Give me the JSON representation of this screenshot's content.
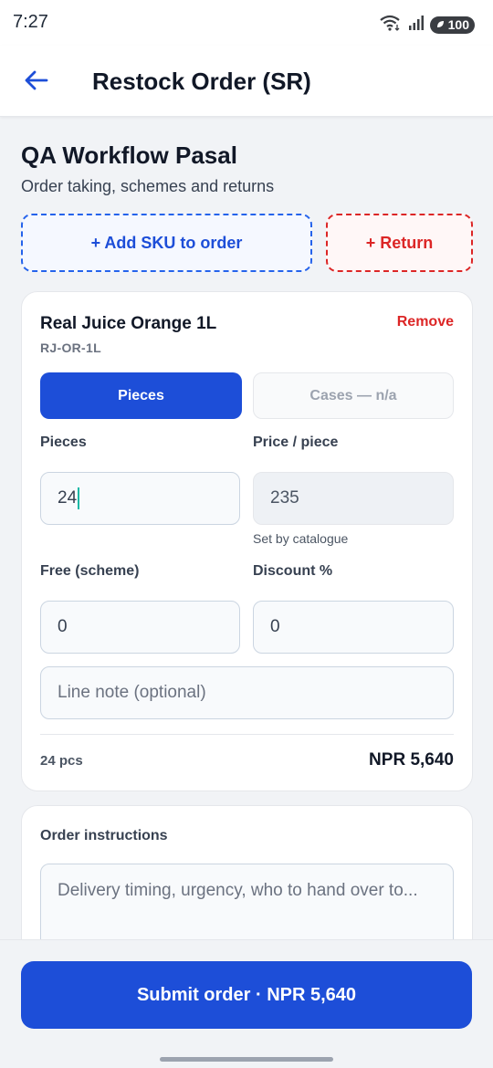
{
  "status": {
    "time": "7:27",
    "battery": "100"
  },
  "app_bar": {
    "title": "Restock Order (SR)",
    "back_icon": "arrow-left-icon"
  },
  "store": {
    "name": "QA Workflow Pasal",
    "subtitle": "Order taking, schemes and returns"
  },
  "actions": {
    "add_sku": "+ Add SKU to order",
    "return": "+ Return"
  },
  "item": {
    "name": "Real Juice Orange 1L",
    "sku": "RJ-OR-1L",
    "remove": "Remove",
    "unit_toggle": {
      "pieces": "Pieces",
      "cases": "Cases — n/a",
      "selected": "Pieces"
    },
    "pieces_label": "Pieces",
    "pieces_value": "24",
    "price_label": "Price / piece",
    "price_value": "235",
    "price_hint": "Set by catalogue",
    "free_label": "Free (scheme)",
    "free_value": "0",
    "discount_label": "Discount %",
    "discount_value": "0",
    "note_placeholder": "Line note (optional)",
    "qty_summary": "24 pcs",
    "line_total": "NPR 5,640"
  },
  "instructions": {
    "label": "Order instructions",
    "placeholder": "Delivery timing, urgency, who to hand over to..."
  },
  "submit": {
    "label": "Submit order · NPR 5,640"
  },
  "colors": {
    "primary": "#1d4ed8",
    "danger": "#dc2626"
  }
}
